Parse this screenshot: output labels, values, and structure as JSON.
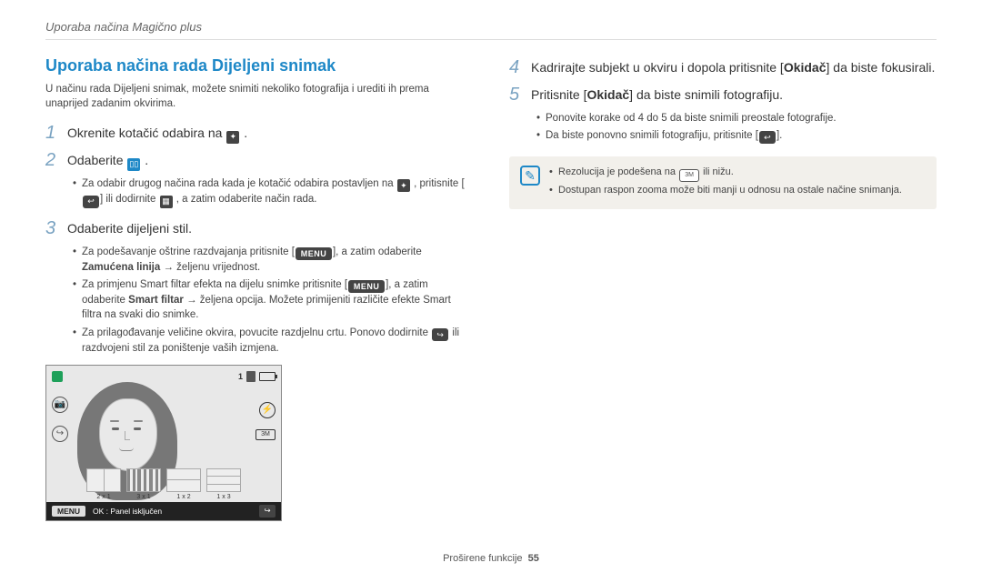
{
  "breadcrumb": "Uporaba načina Magično plus",
  "h2": "Uporaba načina rada Dijeljeni snimak",
  "intro": "U načinu rada Dijeljeni snimak, možete snimiti nekoliko fotografija i urediti ih prema unaprijed zadanim okvirima.",
  "steps_left": {
    "s1": "Okrenite kotačić odabira na ",
    "s1_tail": " .",
    "s2": "Odaberite ",
    "s2_tail": " .",
    "s2_sub": {
      "a_pre": "Za odabir drugog načina rada kada je kotačić odabira postavljen na ",
      "a_mid": " , pritisnite [",
      "a_mid2": "] ili dodirnite ",
      "a_tail": " , a zatim odaberite način rada."
    },
    "s3": "Odaberite dijeljeni stil.",
    "s3_sub": {
      "a_pre": "Za podešavanje oštrine razdvajanja pritisnite [",
      "a_mid": "], a zatim odaberite ",
      "a_bold": "Zamućena linija",
      "a_tail": " → željenu vrijednost.",
      "b_pre": "Za primjenu Smart filtar efekta na dijelu snimke pritisnite [",
      "b_mid": "], a zatim odaberite ",
      "b_bold": "Smart filtar",
      "b_tail": " → željena opcija. Možete primijeniti različite efekte Smart filtra na svaki dio snimke.",
      "c_pre": "Za prilagođavanje veličine okvira, povucite razdjelnu crtu. Ponovo dodirnite ",
      "c_tail": " ili razdvojeni stil za poništenje vaših izmjena."
    }
  },
  "steps_right": {
    "s4_pre": "Kadrirajte subjekt u okviru i dopola pritisnite [",
    "s4_bold": "Okidač",
    "s4_tail": "] da biste fokusirali.",
    "s5_pre": "Pritisnite [",
    "s5_bold": "Okidač",
    "s5_tail": "] da biste snimili fotografiju.",
    "s5_sub": {
      "a": "Ponovite korake od 4 do 5 da biste snimili preostale fotografije.",
      "b_pre": "Da biste ponovno snimili fotografiju, pritisnite [",
      "b_tail": "]."
    }
  },
  "note": {
    "a_pre": "Rezolucija je podešena na ",
    "a_tail": " ili nižu.",
    "b": "Dostupan raspon zooma može biti manji u odnosu na ostale načine snimanja."
  },
  "shot": {
    "count": "1",
    "thumbs": {
      "a": "2 x 1",
      "b": "3 x 1",
      "c": "1 x 2",
      "d": "1 x 3"
    },
    "menu": "MENU",
    "status": "OK : Panel isključen"
  },
  "footer": {
    "label": "Proširene funkcije",
    "page": "55"
  },
  "menu_label": "MENU",
  "res_label": "3M"
}
